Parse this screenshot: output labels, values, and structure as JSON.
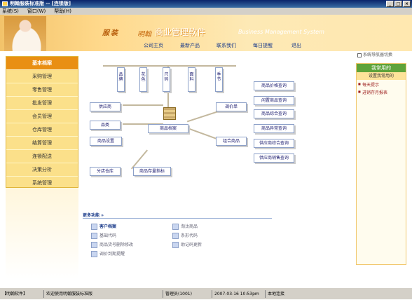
{
  "window": {
    "title": "明翰服装标准版 -- [连锁版]",
    "controls": [
      "_",
      "□",
      "×"
    ]
  },
  "menu": [
    "系统(S)",
    "窗口(W)",
    "帮助(H)"
  ],
  "banner": {
    "brand_a": "服装",
    "brand_b": "明翰",
    "brand_c": "商业管理软件",
    "brand_d": "Business Management System"
  },
  "topnav": [
    "公司主页",
    "最新产品",
    "联系我们",
    "每日提醒",
    "退出"
  ],
  "sysnav_label": "系统导航器切换",
  "sidebar": [
    "基本档案",
    "采购管理",
    "零售管理",
    "批发管理",
    "会员管理",
    "仓库管理",
    "结算管理",
    "连锁配送",
    "决策分析",
    "系统管理"
  ],
  "diagram": {
    "top": [
      "品牌",
      "花色",
      "尺码",
      "面料",
      "季节"
    ],
    "left": [
      "供应商",
      "品类",
      "商品设置"
    ],
    "center": "商品档案",
    "right": [
      "调价单",
      "组合商品"
    ],
    "queries": [
      "商品价格查询",
      "闲置商品查询",
      "商品综合查询",
      "商品异常查询",
      "供应商综合查询",
      "供应商销售查询"
    ],
    "bottom": [
      "分店仓库",
      "商品存量指标"
    ]
  },
  "more": {
    "title": "更多功能",
    "col1": [
      "客户档案",
      "基础代码",
      "商品货号删除修改",
      "调价到期提醒"
    ],
    "col2": [
      "淘汰商品",
      "条形代码",
      "助记码更新"
    ]
  },
  "rpanel": {
    "title": "我常用的",
    "subtitle": "设置我常用的",
    "items": [
      "每天提示",
      "进销存月报表"
    ]
  },
  "status": {
    "app": "【明翰软件】",
    "welcome": "欢迎使用明翰服装标准版",
    "user": "管理员(1001)",
    "datetime": "2007-03-16 10:53pm",
    "conn": "本地连接"
  }
}
